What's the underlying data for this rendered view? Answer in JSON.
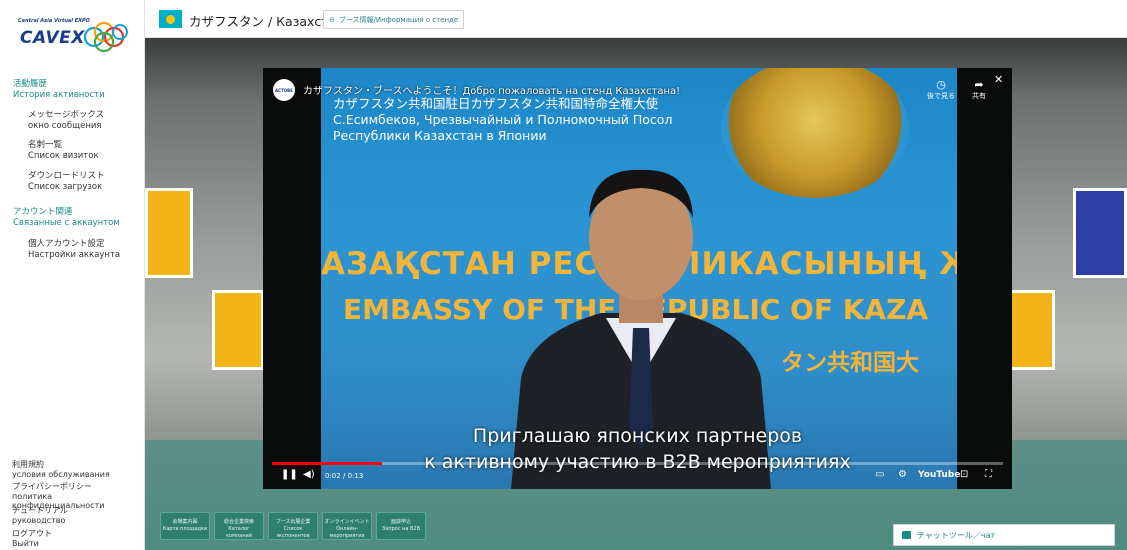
{
  "sidebar": {
    "logo_tagline": "Central Asia Virtual EXPO",
    "logo_text": "CAVEX",
    "activity_section_ja": "活動履歴",
    "activity_section_ru": "История активности",
    "items": [
      {
        "ja": "メッセージボックス",
        "ru": "окно сообщения"
      },
      {
        "ja": "名刺一覧",
        "ru": "Список визиток"
      },
      {
        "ja": "ダウンロードリスト",
        "ru": "Список загрузок"
      }
    ],
    "account_section_ja": "アカウント関連",
    "account_section_ru": "Связанные с аккаунтом",
    "account_items": [
      {
        "ja": "個人アカウント設定",
        "ru": "Настройки аккаунта"
      }
    ],
    "footer": [
      {
        "ja": "利用規約",
        "ru": "условия обслуживания"
      },
      {
        "ja": "プライバシーポリシー",
        "ru": "политика конфиденциальности"
      },
      {
        "ja": "チュートリアル",
        "ru": "руководство"
      },
      {
        "ja": "ログアウト",
        "ru": "Выйти"
      }
    ]
  },
  "header": {
    "title": "カザフスタン / Казахстан",
    "booth_info": "ブース情報/Информация о стенде"
  },
  "bottom_nav": [
    {
      "ja": "会場案内図",
      "ru": "Карта площадки"
    },
    {
      "ja": "総合企業検索",
      "ru": "Каталог компаний"
    },
    {
      "ja": "ブース出展企業",
      "ru": "Список экспонентов"
    },
    {
      "ja": "オンラインイベント",
      "ru": "Онлайн-мероприятия"
    },
    {
      "ja": "面談申込",
      "ru": "Запрос на B2B"
    }
  ],
  "chat": {
    "label": "チャットツール／чат"
  },
  "video": {
    "channel_logo": "ACTOBE",
    "title": "カザフスタン・ブースへようこそ！Добро пожаловать на стенд Казахстана!",
    "overlay_lines": [
      "カザフスタン共和国駐日カザフスタン共和国特命全権大使",
      "С.Есимбеков, Чрезвычайный и Полномочный Посол",
      "Республики Казахстан в Японии"
    ],
    "wall_line1": "АЗАҚСТАН РЕСПУБЛИКАСЫНЫҢ ЖАП",
    "wall_line2": "EMBASSY OF THE REPUBLIC OF KAZA",
    "wall_line3": "タン共和国大",
    "subtitle_line1": "Приглашаю японских партнеров",
    "subtitle_line2": "к активному участию в B2B мероприятиях",
    "watch_later": "後で見る",
    "share": "共有",
    "time_current": "0:02",
    "time_total": "0:13",
    "progress_fraction": 0.15,
    "youtube_label": "YouTube"
  },
  "colors": {
    "accent": "#1d8a8a",
    "flag": "#00afca",
    "progress": "#ff0000"
  }
}
